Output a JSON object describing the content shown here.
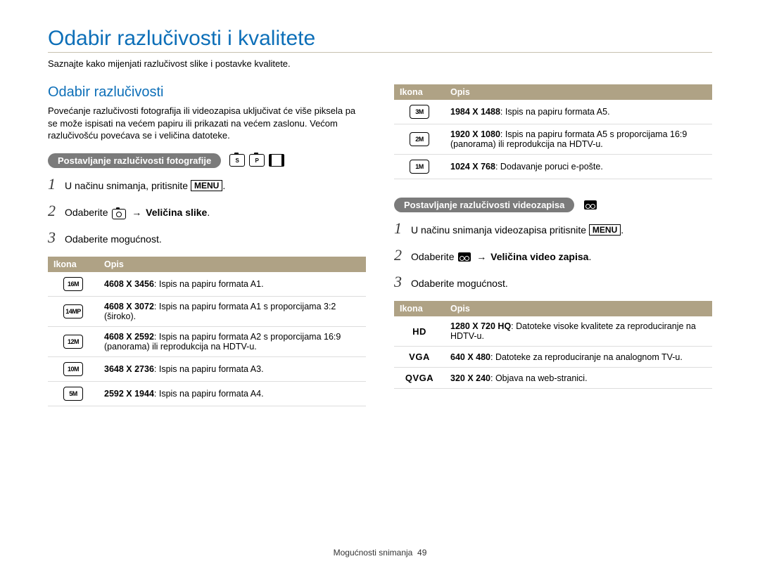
{
  "page": {
    "title": "Odabir razlučivosti i kvalitete",
    "intro": "Saznajte kako mijenjati razlučivost slike i postavke kvalitete."
  },
  "left": {
    "section_title": "Odabir razlučivosti",
    "section_desc": "Povećanje razlučivosti fotografija ili videozapisa uključivat će više piksela pa se može ispisati na većem papiru ili prikazati na većem zaslonu. Većom razlučivošću povećava se i veličina datoteke.",
    "photo_pill": "Postavljanje razlučivosti fotografije",
    "steps": {
      "1": "U načinu snimanja, pritisnite ",
      "1_menu": "MENU",
      "1_suffix": ".",
      "2_prefix": "Odaberite ",
      "2_arrow": "→",
      "2_bold": " Veličina slike",
      "2_suffix": ".",
      "3": "Odaberite mogućnost."
    },
    "table": {
      "h1": "Ikona",
      "h2": "Opis",
      "rows": [
        {
          "icon": "16M",
          "bold": "4608 X 3456",
          "desc": ": Ispis na papiru formata A1."
        },
        {
          "icon": "14MP",
          "bold": "4608 X 3072",
          "desc": ": Ispis na papiru formata A1 s proporcijama 3:2 (široko)."
        },
        {
          "icon": "12M",
          "bold": "4608 X 2592",
          "desc": ": Ispis na papiru formata A2 s proporcijama 16:9 (panorama) ili reprodukcija na HDTV-u."
        },
        {
          "icon": "10M",
          "bold": "3648 X 2736",
          "desc": ": Ispis na papiru formata A3."
        },
        {
          "icon": "5M",
          "bold": "2592 X 1944",
          "desc": ": Ispis na papiru formata A4."
        }
      ]
    }
  },
  "right": {
    "top_table": {
      "h1": "Ikona",
      "h2": "Opis",
      "rows": [
        {
          "icon": "3M",
          "bold": "1984 X 1488",
          "desc": ": Ispis na papiru formata A5."
        },
        {
          "icon": "2M",
          "bold": "1920 X 1080",
          "desc": ": Ispis na papiru formata A5 s proporcijama 16:9 (panorama) ili reprodukcija na HDTV-u."
        },
        {
          "icon": "1M",
          "bold": "1024 X 768",
          "desc": ": Dodavanje poruci e-pošte."
        }
      ]
    },
    "video_pill": "Postavljanje razlučivosti videozapisa",
    "steps": {
      "1": "U načinu snimanja videozapisa pritisnite ",
      "1_menu": "MENU",
      "1_suffix": ".",
      "2_prefix": "Odaberite ",
      "2_arrow": "→",
      "2_bold": " Veličina video zapisa",
      "2_suffix": ".",
      "3": "Odaberite mogućnost."
    },
    "video_table": {
      "h1": "Ikona",
      "h2": "Opis",
      "rows": [
        {
          "icon": "HD",
          "bold": "1280 X 720 HQ",
          "desc": ": Datoteke visoke kvalitete za reproduciranje na HDTV-u."
        },
        {
          "icon": "VGA",
          "bold": "640 X 480",
          "desc": ": Datoteke za reproduciranje na analognom TV-u."
        },
        {
          "icon": "QVGA",
          "bold": "320 X 240",
          "desc": ": Objava na web-stranici."
        }
      ]
    }
  },
  "footer": {
    "section": "Mogućnosti snimanja",
    "page_number": "49"
  }
}
